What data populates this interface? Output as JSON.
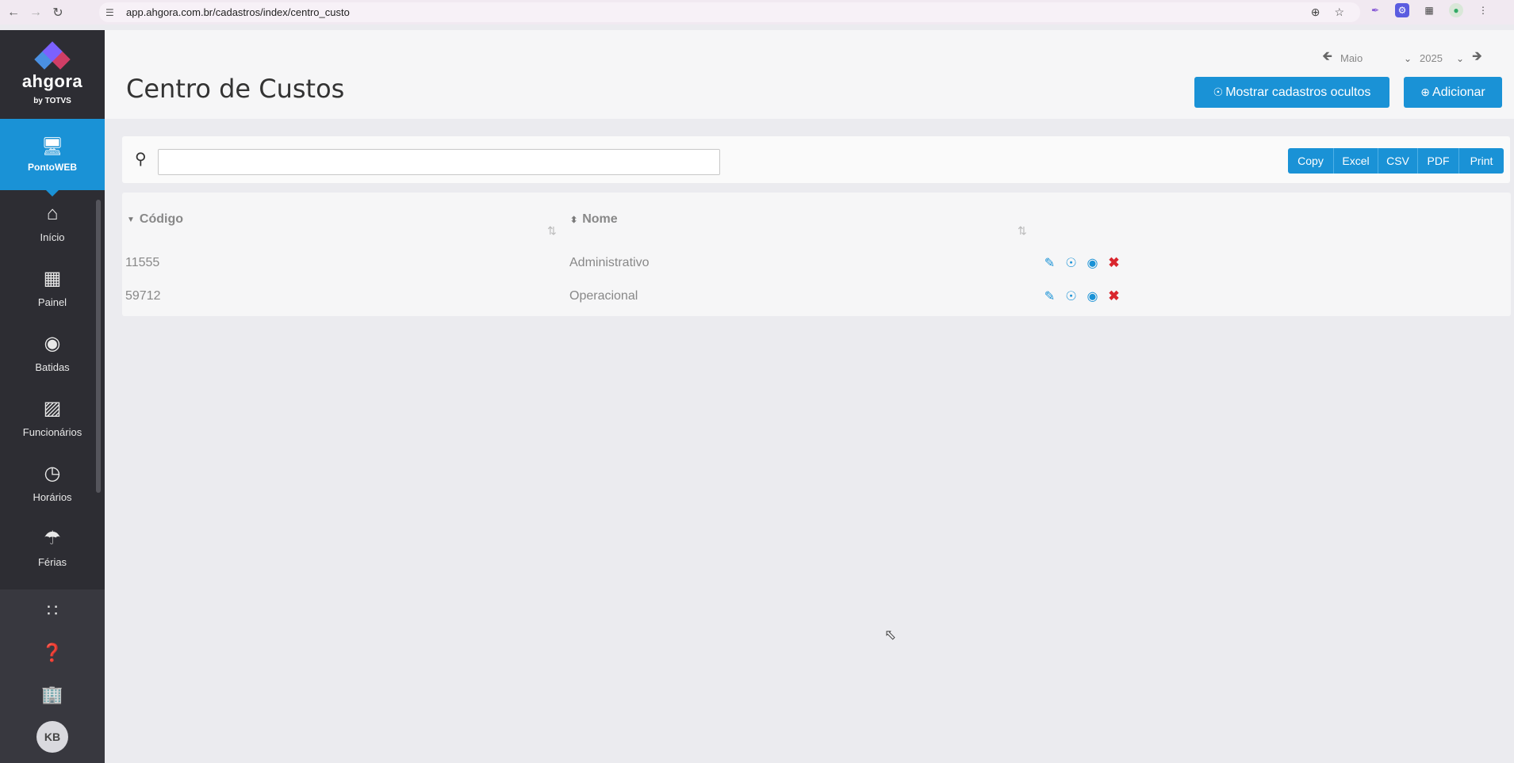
{
  "browser": {
    "url": "app.ahgora.com.br/cadastros/index/centro_custo"
  },
  "sidebar": {
    "logo_text": "ahgora",
    "logo_sub": "by TOTVS",
    "active_app": "PontoWEB",
    "items": [
      {
        "label": "Início",
        "icon": "home-icon"
      },
      {
        "label": "Painel",
        "icon": "dashboard-icon"
      },
      {
        "label": "Batidas",
        "icon": "fingerprint-icon"
      },
      {
        "label": "Funcionários",
        "icon": "badge-icon"
      },
      {
        "label": "Horários",
        "icon": "clock-icon"
      },
      {
        "label": "Férias",
        "icon": "beach-umbrella-icon"
      }
    ],
    "avatar_initials": "KB"
  },
  "header": {
    "title": "Centro de Custos",
    "month": "Maio",
    "year": "2025",
    "show_hidden_label": "Mostrar cadastros ocultos",
    "add_label": "Adicionar"
  },
  "toolbar": {
    "search_value": "",
    "export_buttons": [
      "Copy",
      "Excel",
      "CSV",
      "PDF",
      "Print"
    ]
  },
  "table": {
    "columns": [
      "Código",
      "Nome"
    ],
    "rows": [
      {
        "codigo": "11555",
        "nome": "Administrativo"
      },
      {
        "codigo": "59712",
        "nome": "Operacional"
      }
    ]
  },
  "colors": {
    "primary": "#1a92d6",
    "sidebar": "#2d2d33",
    "danger": "#d9262e"
  }
}
